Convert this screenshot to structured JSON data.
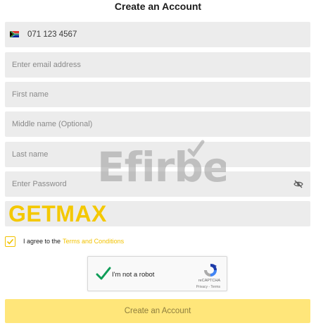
{
  "form": {
    "title": "Create an Account",
    "phone": {
      "value": "071 123 4567",
      "country_flag": "south-africa-flag"
    },
    "email": {
      "placeholder": "Enter email address"
    },
    "first_name": {
      "placeholder": "First name"
    },
    "middle_name": {
      "placeholder": "Middle name (Optional)"
    },
    "last_name": {
      "placeholder": "Last name"
    },
    "password": {
      "placeholder": "Enter Password",
      "toggle_icon": "eye-slash-icon"
    },
    "promo_code": {
      "value": "GETMAX"
    },
    "agree": {
      "checked": true,
      "text": "I agree to the",
      "link_text": "Terms and Conditions"
    },
    "recaptcha": {
      "label": "I'm not a robot",
      "brand": "reCAPTCHA",
      "links": "Privacy - Terms"
    },
    "submit_label": "Create an Account"
  },
  "watermark": {
    "text": "Efirbet"
  },
  "colors": {
    "accent": "#f2c200",
    "promo_text": "#f4c800",
    "button_bg": "#ffe67a",
    "button_text": "#8d7d3e",
    "field_bg": "#ececec",
    "recaptcha_check": "#0f9d58"
  }
}
